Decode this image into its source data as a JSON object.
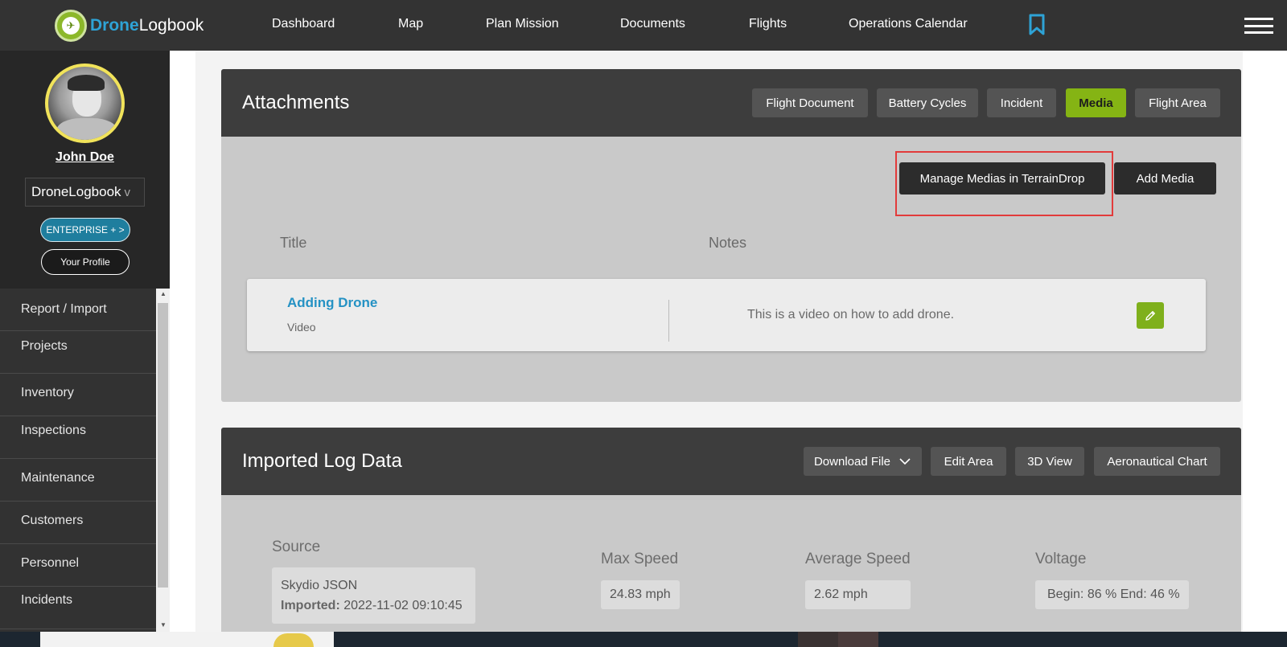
{
  "app": {
    "logo_part1": "Drone",
    "logo_part2": "Logbook"
  },
  "nav": {
    "items": [
      "Dashboard",
      "Map",
      "Plan Mission",
      "Documents",
      "Flights",
      "Operations Calendar"
    ]
  },
  "user": {
    "name": "John Doe",
    "org": "DroneLogbook",
    "org_chevron": "v",
    "plan_button": "ENTERPRISE + >",
    "profile_button": "Your Profile"
  },
  "sidebar": {
    "items": [
      "Report / Import",
      "Projects",
      "Inventory",
      "Inspections",
      "Maintenance",
      "Customers",
      "Personnel",
      "Incidents"
    ]
  },
  "attachments": {
    "title": "Attachments",
    "tabs": [
      "Flight Document",
      "Battery Cycles",
      "Incident",
      "Media",
      "Flight Area"
    ],
    "active_tab": "Media",
    "manage_button": "Manage Medias in TerrainDrop",
    "add_button": "Add Media",
    "col_title": "Title",
    "col_notes": "Notes",
    "rows": [
      {
        "title": "Adding Drone",
        "type": "Video",
        "notes": "This is a video on how to add drone."
      }
    ]
  },
  "log_data": {
    "title": "Imported Log Data",
    "buttons": [
      "Download File",
      "Edit Area",
      "3D View",
      "Aeronautical Chart"
    ],
    "source_label": "Source",
    "source_value": "Skydio JSON",
    "imported_label": "Imported:",
    "imported_value": "2022-11-02 09:10:45",
    "max_speed_label": "Max Speed",
    "max_speed_value": "24.83 mph",
    "avg_speed_label": "Average Speed",
    "avg_speed_value": "2.62 mph",
    "voltage_label": "Voltage",
    "voltage_value": "Begin: 86 % End: 46 %"
  },
  "colors": {
    "accent_green": "#85b414",
    "link_blue": "#2592c4",
    "nav_bg": "#333333",
    "highlight_red": "#e23b3b"
  },
  "icons": [
    "bookmark-icon",
    "menu-icon",
    "chevron-down-icon",
    "pencil-icon",
    "logo-icon"
  ]
}
